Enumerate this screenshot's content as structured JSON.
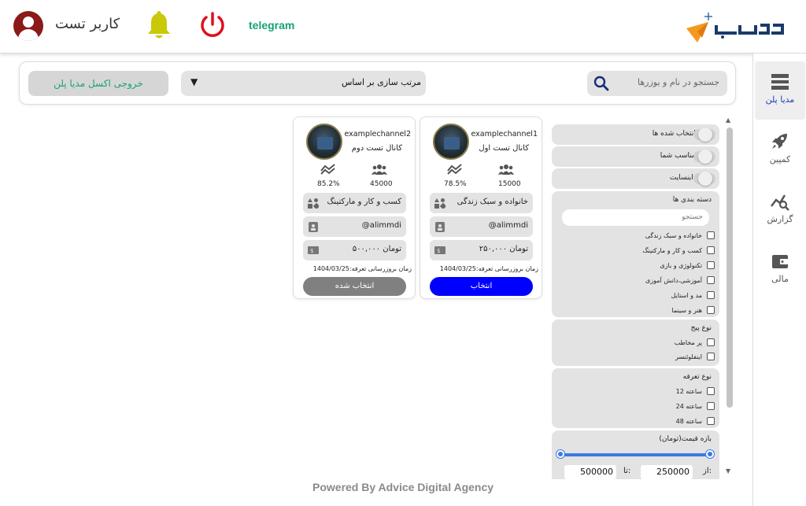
{
  "header": {
    "user_name": "کاربر تست",
    "telegram": "telegram",
    "icons": [
      "user-avatar-icon",
      "bell-icon",
      "power-icon",
      "logo"
    ]
  },
  "sidebar": {
    "items": [
      {
        "label": "مدیا پلن",
        "icon": "media-plan-icon",
        "active": true
      },
      {
        "label": "کمپین",
        "icon": "rocket-icon",
        "active": false
      },
      {
        "label": "گزارش",
        "icon": "report-icon",
        "active": false
      },
      {
        "label": "مالی",
        "icon": "wallet-icon",
        "active": false
      }
    ]
  },
  "toolbar": {
    "search_placeholder": "جستجو در نام و یوزرها",
    "sort_label": "مرتب سازی بر اساس",
    "export_label": "خروجی اکسل مدیا پلن"
  },
  "filters": {
    "toggles": [
      "فقط انتخاب شده ها",
      "فقط مناسب شما",
      "دارای اینسایت"
    ],
    "categories": {
      "title": "دسته بندی ها",
      "search_placeholder": "جستجو",
      "items": [
        "خانواده و سبک زندگی",
        "کسب و کار و مارکتینگ",
        "تکنولوژی و بازی",
        "آموزشی،دانش آموزی",
        "مد و استایل",
        "هنر و سینما"
      ]
    },
    "page_type": {
      "title": "نوع پیج",
      "items": [
        "پر مخاطب",
        "اینفلوئنسر"
      ]
    },
    "tariff_type": {
      "title": "نوع تعرفه",
      "items": [
        "12 ساعته",
        "24 ساعته",
        "48 ساعته"
      ]
    },
    "price_range": {
      "title": "بازه قیمت(تومان)",
      "from_label": "از:",
      "to_label": "تا:",
      "from_value": "250000",
      "to_value": "500000"
    }
  },
  "cards": [
    {
      "channel": "examplechannel1",
      "title": "کانال تست اول",
      "members": "15000",
      "engagement": "78.5%",
      "category": "خانواده و سبک زندگی",
      "admin": "@alimmdi",
      "price": "۲۵۰,۰۰۰ تومان",
      "updated": "زمان بروزرسانی تعرفه:1404/03/25",
      "button": "انتخاب"
    },
    {
      "channel": "examplechannel2",
      "title": "کانال تست دوم",
      "members": "45000",
      "engagement": "85.2%",
      "category": "کسب و کار و مارکتینگ",
      "admin": "@alimmdi",
      "price": "۵۰۰,۰۰۰ تومان",
      "updated": "زمان بروزرسانی تعرفه:1404/03/25",
      "button": "انتخاب شده"
    }
  ],
  "footer": {
    "text": "Powered By Advice Digital Agency"
  },
  "colors": {
    "select_blue": "#0000ff",
    "selected_grey": "#808080",
    "accent_green": "#16a36f",
    "nav_active": "#1d3fbf"
  }
}
